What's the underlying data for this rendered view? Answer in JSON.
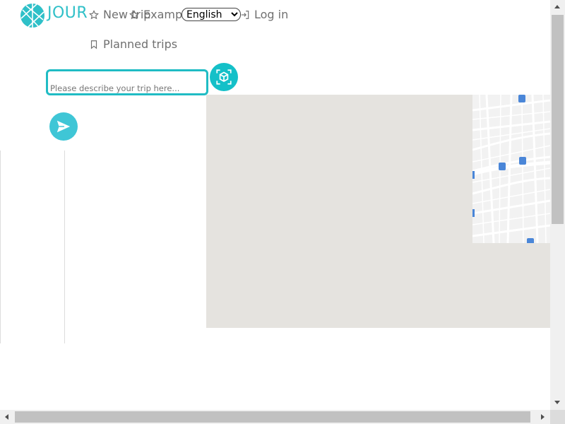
{
  "header": {
    "brand": "JOUR",
    "nav": {
      "new_trip": "New trip",
      "examples": "Examp",
      "login": "Log in",
      "planned_trips": "Planned trips"
    },
    "language": {
      "selected": "English"
    }
  },
  "prompt": {
    "placeholder": "Please describe your trip here..."
  },
  "colors": {
    "accent": "#20bcc4",
    "send_button": "#3fc6d6",
    "map_background": "#e5e3df",
    "bus_stop": "#4a86d8"
  },
  "icons": {
    "logo": "globe-network-icon",
    "new_trip": "star-icon",
    "examples": "star-icon",
    "login": "login-icon",
    "planned_trips": "bookmark-icon",
    "cube": "cube-scan-icon",
    "send": "send-icon",
    "bus_stop": "bus-icon"
  }
}
